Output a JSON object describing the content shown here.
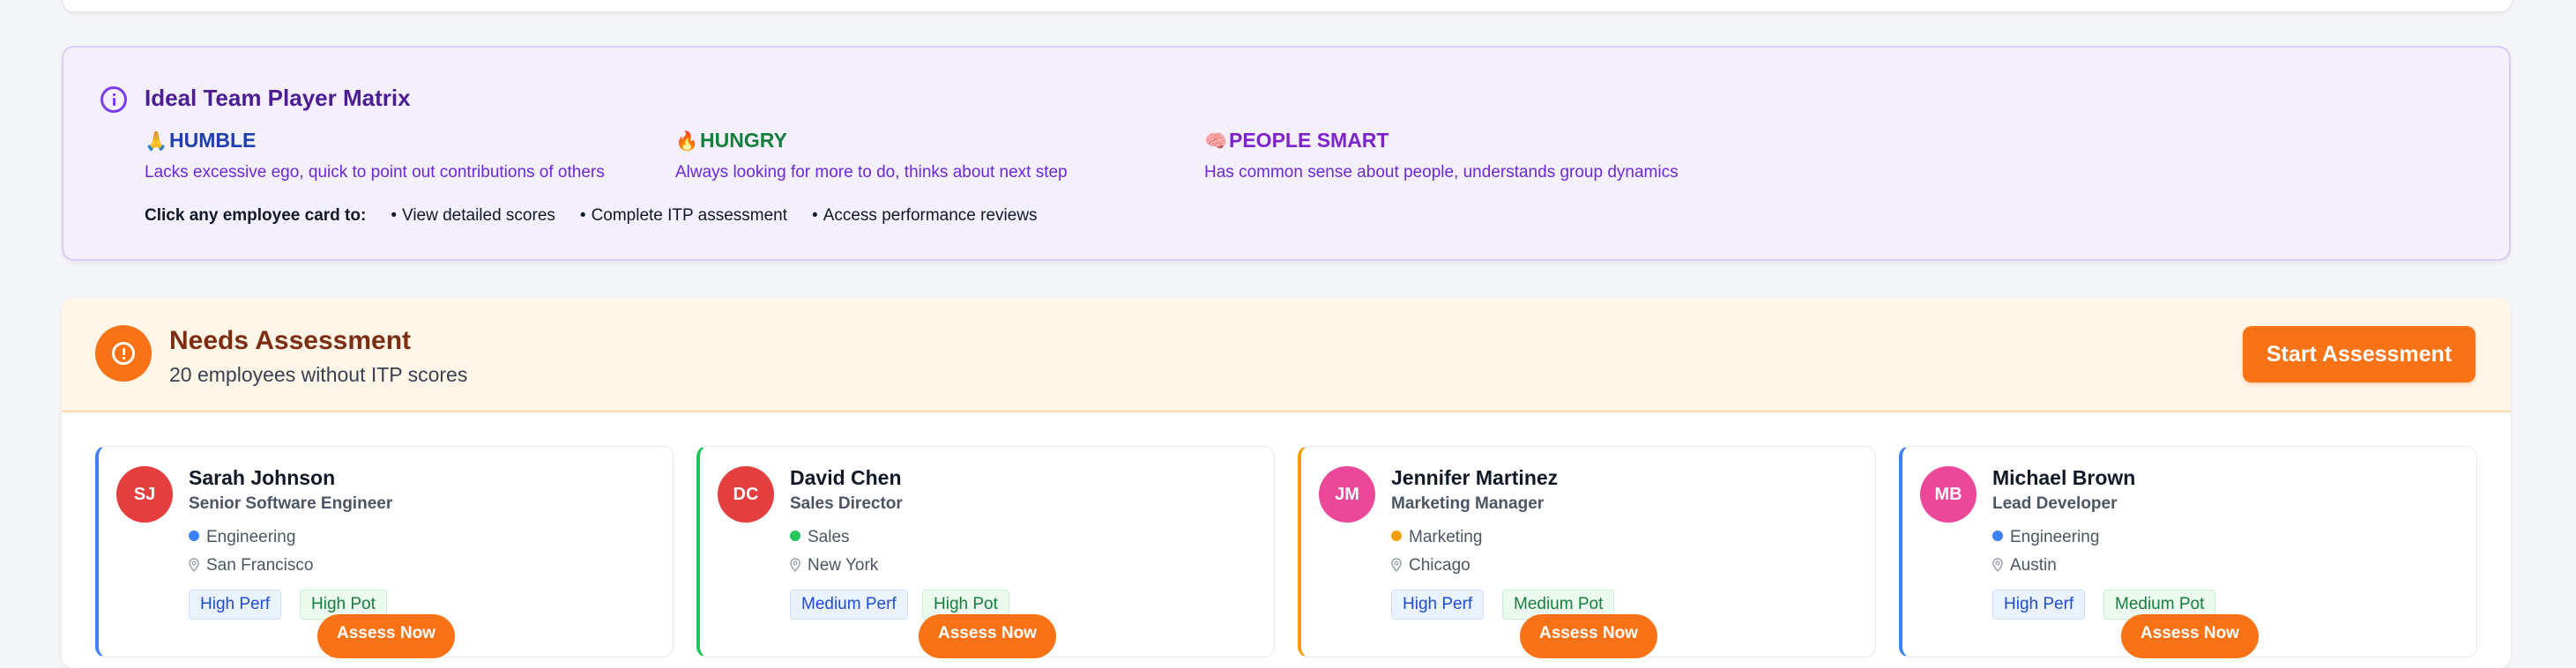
{
  "itp": {
    "title": "Ideal Team Player Matrix",
    "traits": [
      {
        "emoji": "🙏",
        "name": "HUMBLE",
        "description": "Lacks excessive ego, quick to point out contributions of others"
      },
      {
        "emoji": "🔥",
        "name": "HUNGRY",
        "description": "Always looking for more to do, thinks about next step"
      },
      {
        "emoji": "🧠",
        "name": "PEOPLE SMART",
        "description": "Has common sense about people, understands group dynamics"
      }
    ],
    "click_lead": "Click any employee card to:",
    "click_actions": [
      "View detailed scores",
      "Complete ITP assessment",
      "Access performance reviews"
    ]
  },
  "needs": {
    "title": "Needs Assessment",
    "subtitle": "20 employees without ITP scores",
    "start_label": "Start Assessment",
    "assess_label": "Assess Now",
    "employees": [
      {
        "initials": "SJ",
        "name": "Sarah Johnson",
        "role": "Senior Software Engineer",
        "department": "Engineering",
        "location": "San Francisco",
        "performance": "High Perf",
        "potential": "High Pot",
        "avatar_color": "#e53e3e",
        "dept_color": "#3b82f6"
      },
      {
        "initials": "DC",
        "name": "David Chen",
        "role": "Sales Director",
        "department": "Sales",
        "location": "New York",
        "performance": "Medium Perf",
        "potential": "High Pot",
        "avatar_color": "#e53e3e",
        "dept_color": "#22c55e"
      },
      {
        "initials": "JM",
        "name": "Jennifer Martinez",
        "role": "Marketing Manager",
        "department": "Marketing",
        "location": "Chicago",
        "performance": "High Perf",
        "potential": "Medium Pot",
        "avatar_color": "#ec4899",
        "dept_color": "#f59e0b"
      },
      {
        "initials": "MB",
        "name": "Michael Brown",
        "role": "Lead Developer",
        "department": "Engineering",
        "location": "Austin",
        "performance": "High Perf",
        "potential": "Medium Pot",
        "avatar_color": "#ec4899",
        "dept_color": "#3b82f6"
      }
    ]
  },
  "colors": {
    "accent": "#f97316",
    "purple": "#7c3aed"
  },
  "icons": [
    "info-icon",
    "alert-icon",
    "map-pin-icon"
  ]
}
